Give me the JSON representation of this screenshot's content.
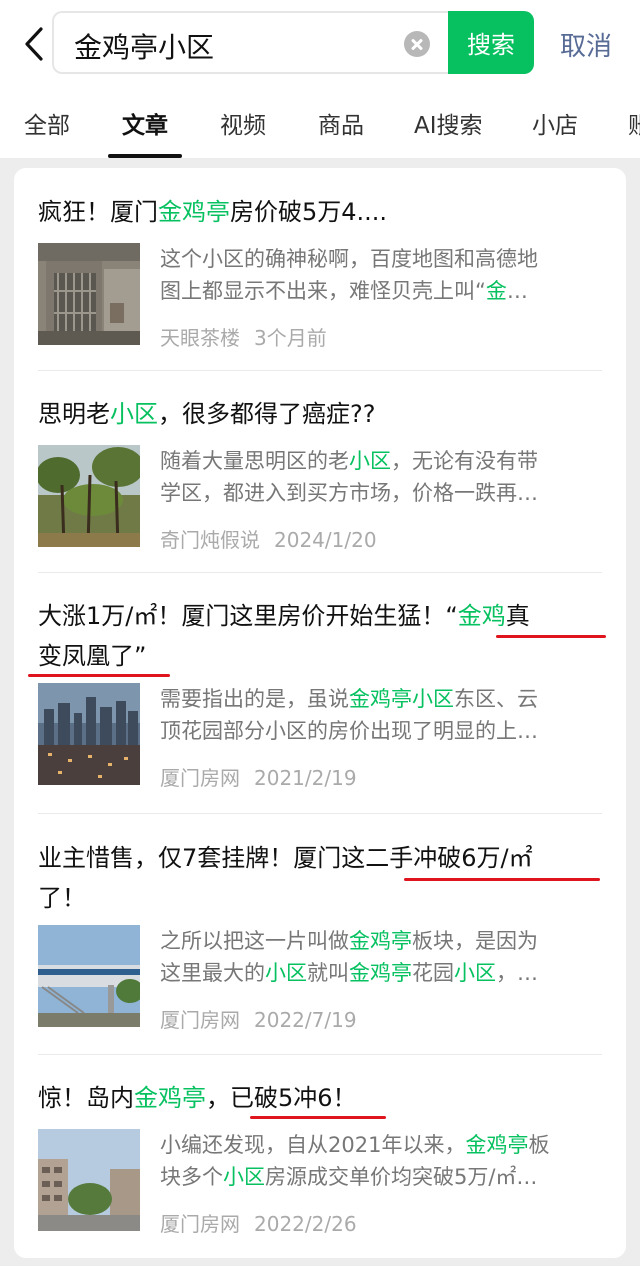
{
  "search": {
    "query": "金鸡亭小区",
    "button_label": "搜索",
    "cancel_label": "取消"
  },
  "tabs": [
    {
      "label": "全部"
    },
    {
      "label": "文章"
    },
    {
      "label": "视频"
    },
    {
      "label": "商品"
    },
    {
      "label": "AI搜索"
    },
    {
      "label": "小店"
    },
    {
      "label": "账"
    }
  ],
  "active_tab": "文章",
  "articles": [
    {
      "title": [
        "疯狂！厦门",
        "金鸡亭",
        "房价破5万4...."
      ],
      "snippet": [
        [
          "这个小区的确神秘啊，百度地图和高德地"
        ],
        [
          "图上都显示不出来，难怪贝壳上叫“",
          "金",
          "…"
        ]
      ],
      "source": "天眼茶楼",
      "date": "3个月前"
    },
    {
      "title": [
        "思明老",
        "小区",
        "，很多都得了癌症??"
      ],
      "snippet": [
        [
          "随着大量思明区的老",
          "小区",
          "，无论有没有带"
        ],
        [
          "学区，都进入到买方市场，价格一跌再…"
        ]
      ],
      "source": "奇门炖假说",
      "date": "2024/1/20"
    },
    {
      "title_line1": [
        "大涨1万/㎡！厦门这里房价开始生猛！“",
        "金鸡",
        "真"
      ],
      "title_line2": "变凤凰了”",
      "snippet": [
        [
          "需要指出的是，虽说",
          "金鸡亭小区",
          "东区、云"
        ],
        [
          "顶花园部分小区的房价出现了明显的上…"
        ]
      ],
      "source": "厦门房网",
      "date": "2021/2/19"
    },
    {
      "title_line1": "业主惜售，仅7套挂牌！厦门这二手冲破6万/㎡",
      "title_line2": "了！",
      "snippet": [
        [
          "之所以把这一片叫做",
          "金鸡亭",
          "板块，是因为"
        ],
        [
          "这里最大的",
          "小区",
          "就叫",
          "金鸡亭",
          "花园",
          "小区",
          "，…"
        ]
      ],
      "source": "厦门房网",
      "date": "2022/7/19"
    },
    {
      "title": [
        "惊！岛内",
        "金鸡亭",
        "，已破5冲6！"
      ],
      "snippet": [
        [
          "小编还发现，自从2021年以来，",
          "金鸡亭",
          "板"
        ],
        [
          "块多个",
          "小区",
          "房源成交单价均突破5万/㎡…"
        ]
      ],
      "source": "厦门房网",
      "date": "2022/2/26"
    }
  ],
  "colors": {
    "accent": "#07c160",
    "link": "#576b95",
    "annotation": "#e0141d"
  }
}
